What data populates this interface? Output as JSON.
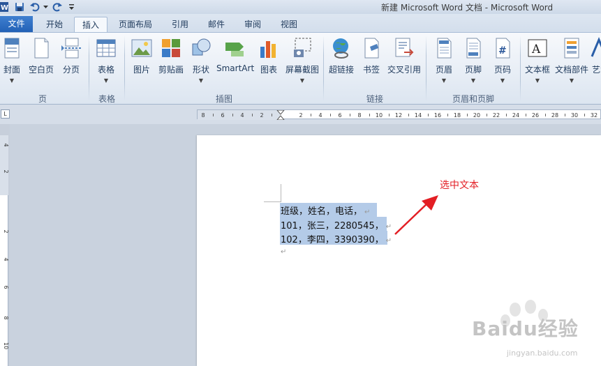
{
  "window": {
    "title": "新建 Microsoft Word 文档 - Microsoft Word"
  },
  "tabs": [
    {
      "label": "文件"
    },
    {
      "label": "开始"
    },
    {
      "label": "插入"
    },
    {
      "label": "页面布局"
    },
    {
      "label": "引用"
    },
    {
      "label": "邮件"
    },
    {
      "label": "审阅"
    },
    {
      "label": "视图"
    }
  ],
  "ribbon": {
    "buttons": {
      "cover": "封面",
      "blank": "空白页",
      "pagebreak": "分页",
      "table": "表格",
      "picture": "图片",
      "clipart": "剪贴画",
      "shapes": "形状",
      "smartart": "SmartArt",
      "chart": "图表",
      "screenshot": "屏幕截图",
      "hyperlink": "超链接",
      "bookmark": "书签",
      "crossref": "交叉引用",
      "header": "页眉",
      "footer": "页脚",
      "pagenum": "页码",
      "textbox": "文本框",
      "quickparts": "文档部件",
      "wordart": "艺术"
    },
    "groups": {
      "pages": "页",
      "tables": "表格",
      "illustrations": "插图",
      "links": "链接",
      "headerfooter": "页眉和页脚"
    }
  },
  "ruler": {
    "labels": [
      "8",
      "6",
      "4",
      "2",
      "2",
      "4",
      "6",
      "8",
      "10",
      "12",
      "14",
      "16",
      "18",
      "20",
      "22",
      "24",
      "26",
      "28",
      "30",
      "32"
    ],
    "vlabels": [
      "4",
      "2",
      "2",
      "4",
      "6",
      "8",
      "10"
    ]
  },
  "document": {
    "lines": [
      "班级，姓名，电话，",
      "101，张三，2280545，",
      "102，李四，3390390，"
    ],
    "paragraph_mark": "↵"
  },
  "annotation": {
    "text": "选中文本"
  },
  "watermark": {
    "brand": "Baidu经验",
    "url": "jingyan.baidu.com"
  },
  "colors": {
    "file_tab": "#2a66b8",
    "selection": "#b4cbe8",
    "annotation": "#e31e24"
  }
}
